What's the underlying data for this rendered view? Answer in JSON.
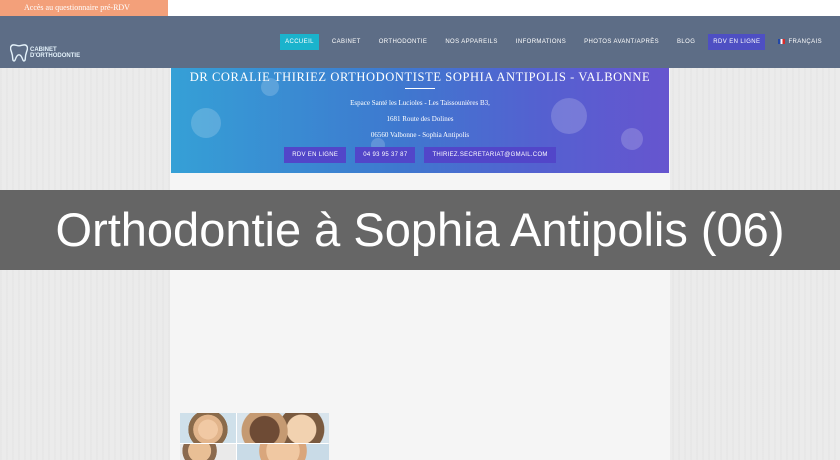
{
  "topbar": {
    "questionnaire_link": "Accès au questionnaire pré-RDV"
  },
  "logo": {
    "text": "CABINET\nD'ORTHODONTIE"
  },
  "nav": {
    "items": [
      {
        "label": "ACCUEIL",
        "style": "active"
      },
      {
        "label": "CABINET",
        "style": "normal"
      },
      {
        "label": "ORTHODONTIE",
        "style": "normal"
      },
      {
        "label": "NOS APPAREILS",
        "style": "normal"
      },
      {
        "label": "INFORMATIONS",
        "style": "normal"
      },
      {
        "label": "PHOTOS AVANT/APRÈS",
        "style": "normal"
      },
      {
        "label": "BLOG",
        "style": "normal"
      },
      {
        "label": "RDV EN LIGNE",
        "style": "cta"
      }
    ],
    "language": "FRANÇAIS"
  },
  "hero": {
    "title": "DR CORALIE THIRIEZ ORTHODONTISTE SOPHIA ANTIPOLIS - VALBONNE",
    "address_line_1": "Espace Santé les Lucioles - Les Taissounières B3,",
    "address_line_2": "1681 Route des Dolines",
    "address_line_3": "06560 Valbonne - Sophia Antipolis",
    "buttons": {
      "rdv": "RDV EN LIGNE",
      "phone": "04 93 95 37 87",
      "email": "THIRIEZ.SECRETARIAT@GMAIL.COM"
    }
  },
  "overlay": {
    "title": "Orthodontie à Sophia Antipolis (06)"
  },
  "colors": {
    "navbar": "#5d6d86",
    "active_nav": "#1bb3cc",
    "cta": "#4e4fc3",
    "questionnaire": "#f3a07a"
  }
}
